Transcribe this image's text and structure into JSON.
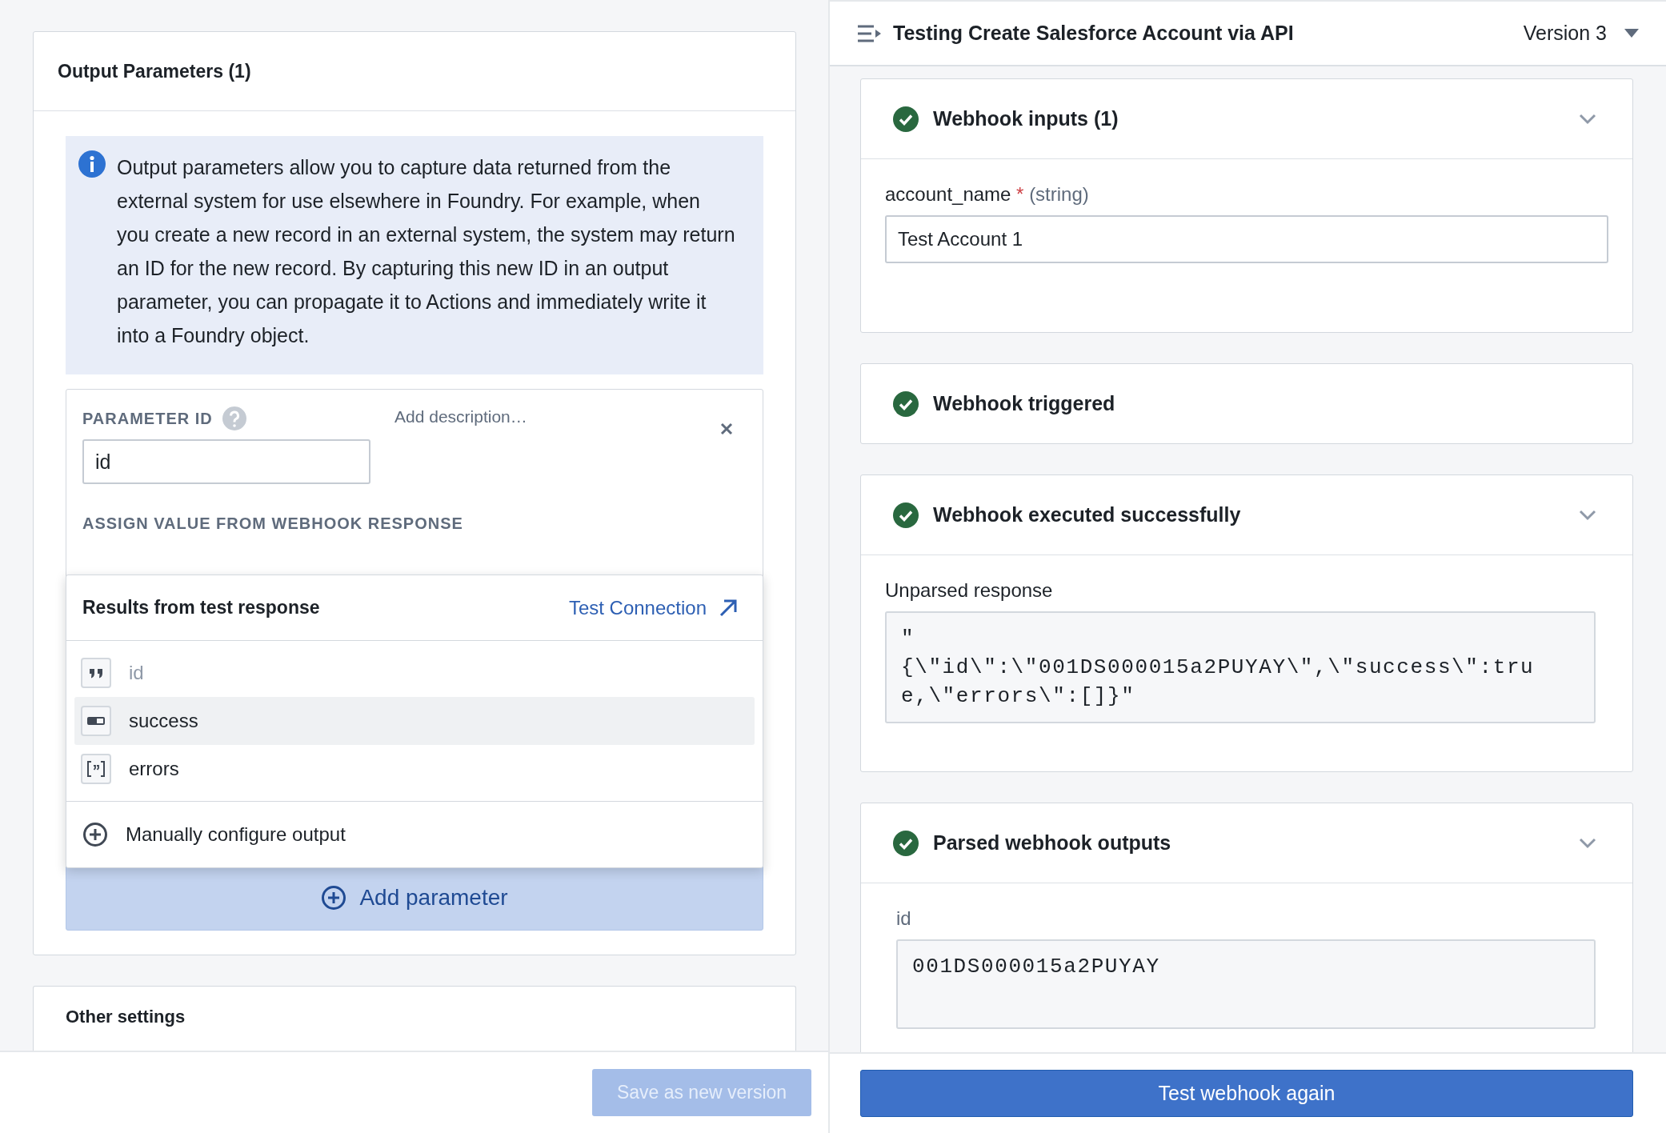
{
  "output_panel": {
    "title": "Output Parameters (1)",
    "info": "Output parameters allow you to capture data returned from the external system for use elsewhere in Foundry. For example, when you create a new record in an external system, the system may return an ID for the new record. By capturing this new ID in an output parameter, you can propagate it to Actions and immediately write it into a Foundry object.",
    "parameter": {
      "label": "PARAMETER ID",
      "value": "id",
      "description_placeholder": "Add description…",
      "assign_label": "ASSIGN VALUE FROM WEBHOOK RESPONSE"
    },
    "results_menu": {
      "title": "Results from test response",
      "link": "Test Connection",
      "items": [
        {
          "label": "id",
          "kind": "string",
          "disabled": true,
          "selected": false
        },
        {
          "label": "success",
          "kind": "boolean",
          "disabled": false,
          "selected": true
        },
        {
          "label": "errors",
          "kind": "array",
          "disabled": false,
          "selected": false
        }
      ],
      "manual_option": "Manually configure output"
    },
    "add_button": "Add parameter"
  },
  "other_settings": {
    "title": "Other settings"
  },
  "save_button": {
    "label": "Save as new version",
    "disabled": true
  },
  "test_panel": {
    "title": "Testing Create Salesforce Account via API",
    "version": "Version 3",
    "sections": [
      {
        "kind": "inputs",
        "succeeded": true,
        "title": "Webhook inputs (1)",
        "field": {
          "name": "account_name",
          "required_mark": "*",
          "type": "(string)",
          "value": "Test Account 1"
        }
      },
      {
        "kind": "event",
        "succeeded": true,
        "title": "Webhook triggered"
      },
      {
        "kind": "response",
        "succeeded": true,
        "title": "Webhook executed successfully",
        "label": "Unparsed response",
        "code": "\"\n{\\\"id\\\":\\\"001DS000015a2PUYAY\\\",\\\"success\\\":true,\\\"errors\\\":[]}\""
      },
      {
        "kind": "outputs",
        "succeeded": true,
        "title": "Parsed webhook outputs",
        "label": "id",
        "code": "001DS000015a2PUYAY"
      }
    ]
  },
  "test_button": "Test webhook again"
}
